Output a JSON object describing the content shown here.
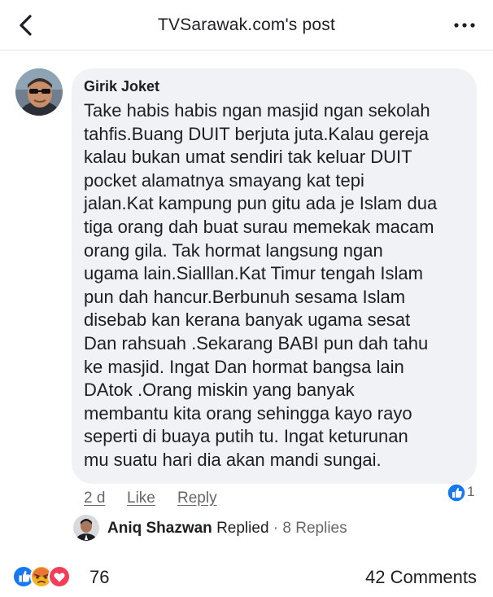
{
  "header": {
    "title": "TVSarawak.com's post",
    "back_icon": "chevron-left-icon",
    "more_icon": "more-horizontal-icon"
  },
  "comment": {
    "author": "Girik Joket",
    "lines": [
      "Take habis habis ngan masjid ngan sekolah",
      "tahfis.Buang DUIT berjuta juta.Kalau gereja",
      "kalau bukan umat sendiri tak keluar DUIT",
      "pocket alamatnya smayang kat tepi",
      "jalan.Kat kampung pun gitu ada je Islam dua",
      "tiga orang dah buat surau memekak macam",
      "orang gila. Tak hormat langsung ngan",
      "ugama lain.Sialllan.Kat Timur tengah Islam",
      "pun dah hancur.Berbunuh sesama Islam",
      "disebab kan kerana banyak ugama sesat",
      "Dan rahsuah .Sekarang BABI pun dah tahu",
      "ke masjid. Ingat Dan hormat bangsa lain",
      "DAtok .Orang miskin yang banyak",
      "membantu kita orang sehingga kayo rayo",
      "seperti di buaya putih tu. Ingat keturunan",
      "mu suatu hari dia akan mandi sungai."
    ],
    "time": "2 d",
    "like_label": "Like",
    "reply_label": "Reply",
    "reaction_icon": "like-icon",
    "reaction_count": "1"
  },
  "reply": {
    "name": "Aniq Shazwan",
    "action": "Replied",
    "separator": "·",
    "count": "8 Replies"
  },
  "footer": {
    "reaction_icons": [
      "like-icon",
      "angry-icon",
      "love-icon"
    ],
    "reaction_count": "76",
    "comments": "42 Comments"
  },
  "colors": {
    "fb_blue": "#1877f2",
    "bubble_bg": "#f0f2f5",
    "secondary_text": "#65676b",
    "angry": "#f7b125",
    "love": "#f33e58"
  }
}
